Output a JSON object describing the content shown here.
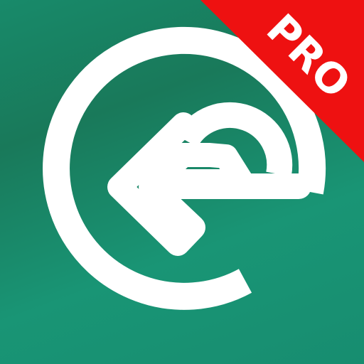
{
  "badge": {
    "label": "PRO",
    "color": "#ee1111",
    "text_color": "#ffffff"
  },
  "logo": {
    "icon": "e-logo-icon",
    "color": "#ffffff"
  },
  "background": {
    "color": "#188c6c"
  }
}
